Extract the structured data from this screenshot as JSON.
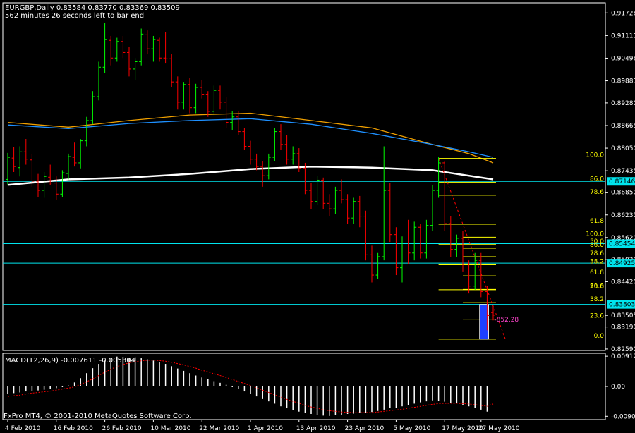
{
  "header": {
    "title_line": "EURGBP,Daily  0.83584 0.83770 0.83369 0.83509",
    "status_line": "562 minutes 26 seconds left to bar end"
  },
  "macd": {
    "label": "MACD(12,26,9) -0.007611 -0.005304",
    "ticks": [
      "0.00912",
      "0.00",
      "-0.0090"
    ]
  },
  "copyright": "FxPro MT4, © 2001-2010 MetaQuotes Software Corp.",
  "colors": {
    "bull": "#00ff00",
    "bear": "#ff0000",
    "axis": "#ffffff",
    "fib": "#ffff00",
    "hline": "#00e5ee",
    "ma_white": "#ffffff",
    "ma_orange": "#f0a000",
    "ma_blue": "#1e90ff",
    "box": "#1e40ff"
  },
  "chart_data": {
    "type": "candlestick-ohlc",
    "symbol": "EURGBP",
    "timeframe": "Daily",
    "ylim": [
      0.8255,
      0.92
    ],
    "x_tick_labels": [
      "4 Feb 2010",
      "16 Feb 2010",
      "26 Feb 2010",
      "10 Mar 2010",
      "22 Mar 2010",
      "1 Apr 2010",
      "13 Apr 2010",
      "23 Apr 2010",
      "5 May 2010",
      "17 May 2010",
      "27 May 2010"
    ],
    "y_ticks": [
      0.91726,
      0.91111,
      0.90496,
      0.89881,
      0.8928,
      0.88665,
      0.8805,
      0.87435,
      0.8685,
      0.86235,
      0.8562,
      0.8502,
      0.8442,
      0.83505,
      0.8319,
      0.8259
    ],
    "y_highlight_labels": [
      {
        "label": "0.87146",
        "value": 0.87146
      },
      {
        "label": "0.85454",
        "value": 0.85454
      },
      {
        "label": "0.84925",
        "value": 0.84925
      },
      {
        "label": "0.83803",
        "value": 0.83803
      }
    ],
    "horizontal_lines": [
      0.87146,
      0.85454,
      0.84925,
      0.83803
    ],
    "ohlc": [
      [
        0.872,
        0.8792,
        0.8706,
        0.878
      ],
      [
        0.8778,
        0.8808,
        0.874,
        0.8755
      ],
      [
        0.8752,
        0.881,
        0.8728,
        0.8795
      ],
      [
        0.8795,
        0.883,
        0.876,
        0.8775
      ],
      [
        0.8773,
        0.879,
        0.87,
        0.8715
      ],
      [
        0.8715,
        0.8735,
        0.8672,
        0.869
      ],
      [
        0.869,
        0.874,
        0.867,
        0.8728
      ],
      [
        0.8726,
        0.876,
        0.8705,
        0.871
      ],
      [
        0.871,
        0.8728,
        0.8665,
        0.868
      ],
      [
        0.868,
        0.8745,
        0.8672,
        0.8738
      ],
      [
        0.8736,
        0.879,
        0.872,
        0.8782
      ],
      [
        0.878,
        0.882,
        0.8755,
        0.8765
      ],
      [
        0.8765,
        0.883,
        0.875,
        0.8825
      ],
      [
        0.8825,
        0.889,
        0.881,
        0.888
      ],
      [
        0.888,
        0.896,
        0.887,
        0.8945
      ],
      [
        0.8945,
        0.904,
        0.8935,
        0.9025
      ],
      [
        0.9025,
        0.9145,
        0.901,
        0.91
      ],
      [
        0.9098,
        0.911,
        0.903,
        0.905
      ],
      [
        0.905,
        0.9105,
        0.904,
        0.9095
      ],
      [
        0.9095,
        0.911,
        0.905,
        0.9065
      ],
      [
        0.9065,
        0.908,
        0.9,
        0.902
      ],
      [
        0.902,
        0.905,
        0.899,
        0.904
      ],
      [
        0.904,
        0.913,
        0.903,
        0.9115
      ],
      [
        0.9113,
        0.9125,
        0.906,
        0.9075
      ],
      [
        0.9075,
        0.911,
        0.904,
        0.91
      ],
      [
        0.9098,
        0.9105,
        0.904,
        0.905
      ],
      [
        0.905,
        0.912,
        0.9035,
        0.9048
      ],
      [
        0.9048,
        0.906,
        0.897,
        0.8985
      ],
      [
        0.8985,
        0.9,
        0.891,
        0.893
      ],
      [
        0.893,
        0.8985,
        0.891,
        0.8978
      ],
      [
        0.8978,
        0.8995,
        0.89,
        0.8915
      ],
      [
        0.8915,
        0.898,
        0.89,
        0.897
      ],
      [
        0.897,
        0.899,
        0.894,
        0.895
      ],
      [
        0.895,
        0.896,
        0.889,
        0.8905
      ],
      [
        0.8905,
        0.8975,
        0.8895,
        0.8962
      ],
      [
        0.8962,
        0.8975,
        0.891,
        0.893
      ],
      [
        0.893,
        0.8945,
        0.886,
        0.8875
      ],
      [
        0.8875,
        0.8905,
        0.8855,
        0.889
      ],
      [
        0.889,
        0.8905,
        0.884,
        0.885
      ],
      [
        0.885,
        0.886,
        0.88,
        0.881
      ],
      [
        0.881,
        0.8825,
        0.876,
        0.8775
      ],
      [
        0.8775,
        0.879,
        0.8745,
        0.8755
      ],
      [
        0.8755,
        0.877,
        0.87,
        0.873
      ],
      [
        0.873,
        0.879,
        0.872,
        0.878
      ],
      [
        0.878,
        0.886,
        0.877,
        0.885
      ],
      [
        0.885,
        0.887,
        0.88,
        0.8815
      ],
      [
        0.8815,
        0.884,
        0.876,
        0.8775
      ],
      [
        0.8775,
        0.881,
        0.876,
        0.879
      ],
      [
        0.879,
        0.8805,
        0.874,
        0.875
      ],
      [
        0.875,
        0.8765,
        0.868,
        0.869
      ],
      [
        0.869,
        0.871,
        0.864,
        0.866
      ],
      [
        0.866,
        0.873,
        0.865,
        0.8718
      ],
      [
        0.8718,
        0.8725,
        0.864,
        0.8655
      ],
      [
        0.8655,
        0.868,
        0.862,
        0.864
      ],
      [
        0.864,
        0.87,
        0.8625,
        0.869
      ],
      [
        0.869,
        0.872,
        0.8655,
        0.8665
      ],
      [
        0.8665,
        0.868,
        0.86,
        0.8615
      ],
      [
        0.8615,
        0.867,
        0.86,
        0.866
      ],
      [
        0.866,
        0.8675,
        0.859,
        0.862
      ],
      [
        0.862,
        0.8635,
        0.85,
        0.8515
      ],
      [
        0.8515,
        0.854,
        0.844,
        0.846
      ],
      [
        0.846,
        0.852,
        0.845,
        0.851
      ],
      [
        0.851,
        0.881,
        0.85,
        0.869
      ],
      [
        0.869,
        0.871,
        0.855,
        0.857
      ],
      [
        0.857,
        0.859,
        0.846,
        0.848
      ],
      [
        0.848,
        0.8565,
        0.844,
        0.8555
      ],
      [
        0.8555,
        0.861,
        0.849,
        0.852
      ],
      [
        0.852,
        0.8605,
        0.85,
        0.859
      ],
      [
        0.859,
        0.86,
        0.8505,
        0.852
      ],
      [
        0.852,
        0.861,
        0.8505,
        0.8595
      ],
      [
        0.8595,
        0.8705,
        0.858,
        0.869
      ],
      [
        0.869,
        0.878,
        0.867,
        0.8765
      ],
      [
        0.8765,
        0.877,
        0.858,
        0.86
      ],
      [
        0.86,
        0.862,
        0.851,
        0.853
      ],
      [
        0.853,
        0.857,
        0.851,
        0.856
      ],
      [
        0.856,
        0.858,
        0.847,
        0.849
      ],
      [
        0.849,
        0.85,
        0.841,
        0.843
      ],
      [
        0.843,
        0.852,
        0.842,
        0.85
      ],
      [
        0.85,
        0.852,
        0.84,
        0.8415
      ],
      [
        0.8415,
        0.843,
        0.831,
        0.835
      ],
      [
        0.8358,
        0.8377,
        0.8337,
        0.8351
      ]
    ],
    "moving_averages": [
      {
        "color": "ma_white",
        "points": [
          [
            0,
            0.8705
          ],
          [
            10,
            0.872
          ],
          [
            20,
            0.8725
          ],
          [
            30,
            0.8735
          ],
          [
            40,
            0.8748
          ],
          [
            50,
            0.8755
          ],
          [
            60,
            0.8752
          ],
          [
            70,
            0.8745
          ],
          [
            80,
            0.872
          ]
        ]
      },
      {
        "color": "ma_orange",
        "points": [
          [
            0,
            0.8875
          ],
          [
            10,
            0.8862
          ],
          [
            20,
            0.888
          ],
          [
            30,
            0.8895
          ],
          [
            40,
            0.89
          ],
          [
            50,
            0.888
          ],
          [
            60,
            0.886
          ],
          [
            70,
            0.8815
          ],
          [
            76,
            0.879
          ],
          [
            80,
            0.8765
          ]
        ]
      },
      {
        "color": "ma_blue",
        "points": [
          [
            0,
            0.8868
          ],
          [
            10,
            0.8858
          ],
          [
            20,
            0.8872
          ],
          [
            30,
            0.888
          ],
          [
            40,
            0.8885
          ],
          [
            50,
            0.887
          ],
          [
            60,
            0.8845
          ],
          [
            70,
            0.8815
          ],
          [
            76,
            0.8795
          ],
          [
            80,
            0.878
          ]
        ]
      }
    ],
    "fib_sets": [
      {
        "x_from": 71,
        "x_to": 80,
        "levels": [
          {
            "label": "100.0",
            "value": 0.8777
          },
          {
            "label": "86.0",
            "value": 0.8712
          },
          {
            "label": "78.6",
            "value": 0.8677
          },
          {
            "label": "61.8",
            "value": 0.8598
          },
          {
            "label": "50.0",
            "value": 0.8543
          },
          {
            "label": "38.2",
            "value": 0.8488
          },
          {
            "label": "23.6",
            "value": 0.842
          },
          {
            "label": "0.0",
            "value": 0.8286
          }
        ]
      },
      {
        "x_from": 75,
        "x_to": 80,
        "levels": [
          {
            "label": "100.0",
            "value": 0.8563
          },
          {
            "label": "86.0",
            "value": 0.8533
          },
          {
            "label": "78.6",
            "value": 0.851
          },
          {
            "label": "61.8",
            "value": 0.8458
          },
          {
            "label": "50.0",
            "value": 0.8421
          },
          {
            "label": "38.2",
            "value": 0.8385
          },
          {
            "label": "23.6",
            "value": 0.834
          }
        ]
      }
    ],
    "trendline": {
      "from": [
        71,
        0.8777
      ],
      "to": [
        82,
        0.8286
      ]
    },
    "box": {
      "x_from": 78,
      "x_to": 79,
      "top": 0.838,
      "bottom": 0.8286
    },
    "box_annotation": {
      "label": "-852.28",
      "value": 0.8339
    },
    "macd_ylim": [
      -0.01,
      0.01
    ],
    "macd_hist": [
      -0.0022,
      -0.002,
      -0.0018,
      -0.0015,
      -0.0013,
      -0.0012,
      -0.001,
      -0.0007,
      -0.0005,
      -0.0002,
      0.0003,
      0.0012,
      0.0025,
      0.004,
      0.0055,
      0.0068,
      0.0078,
      0.0085,
      0.009,
      0.0089,
      0.0087,
      0.0088,
      0.0085,
      0.0082,
      0.0078,
      0.0073,
      0.0068,
      0.0061,
      0.0054,
      0.0047,
      0.004,
      0.0033,
      0.0027,
      0.0022,
      0.0016,
      0.0011,
      0.0005,
      -0.0002,
      -0.0008,
      -0.0015,
      -0.0022,
      -0.003,
      -0.0038,
      -0.0045,
      -0.0052,
      -0.006,
      -0.0066,
      -0.0072,
      -0.0076,
      -0.008,
      -0.0083,
      -0.0086,
      -0.0088,
      -0.0089,
      -0.0087,
      -0.0085,
      -0.0083,
      -0.0082,
      -0.008,
      -0.0079,
      -0.0077,
      -0.0074,
      -0.007,
      -0.0066,
      -0.0064,
      -0.006,
      -0.0057,
      -0.0052,
      -0.0048,
      -0.0045,
      -0.0042,
      -0.0043,
      -0.0046,
      -0.0049,
      -0.0052,
      -0.0056,
      -0.006,
      -0.0064,
      -0.007,
      -0.0076
    ],
    "macd_signal": [
      -0.003,
      -0.0028,
      -0.0026,
      -0.0023,
      -0.002,
      -0.0018,
      -0.0016,
      -0.0014,
      -0.0011,
      -0.0008,
      -0.0005,
      -0.0001,
      0.0006,
      0.0014,
      0.0023,
      0.0033,
      0.0043,
      0.0052,
      0.006,
      0.0066,
      0.0071,
      0.0075,
      0.0077,
      0.0079,
      0.0079,
      0.0078,
      0.0076,
      0.0073,
      0.0069,
      0.0065,
      0.006,
      0.0055,
      0.0049,
      0.0044,
      0.0038,
      0.0033,
      0.0027,
      0.0021,
      0.0015,
      0.0009,
      0.0003,
      -0.0004,
      -0.0011,
      -0.0018,
      -0.0025,
      -0.0032,
      -0.0039,
      -0.0045,
      -0.0051,
      -0.0057,
      -0.0062,
      -0.0066,
      -0.007,
      -0.0073,
      -0.0075,
      -0.0077,
      -0.0078,
      -0.0079,
      -0.0079,
      -0.0079,
      -0.0078,
      -0.0077,
      -0.0075,
      -0.0073,
      -0.0071,
      -0.0069,
      -0.0066,
      -0.0063,
      -0.006,
      -0.0057,
      -0.0054,
      -0.0052,
      -0.0051,
      -0.0051,
      -0.0051,
      -0.0052,
      -0.0053,
      -0.0055,
      -0.0057,
      -0.006,
      -0.0053
    ]
  }
}
